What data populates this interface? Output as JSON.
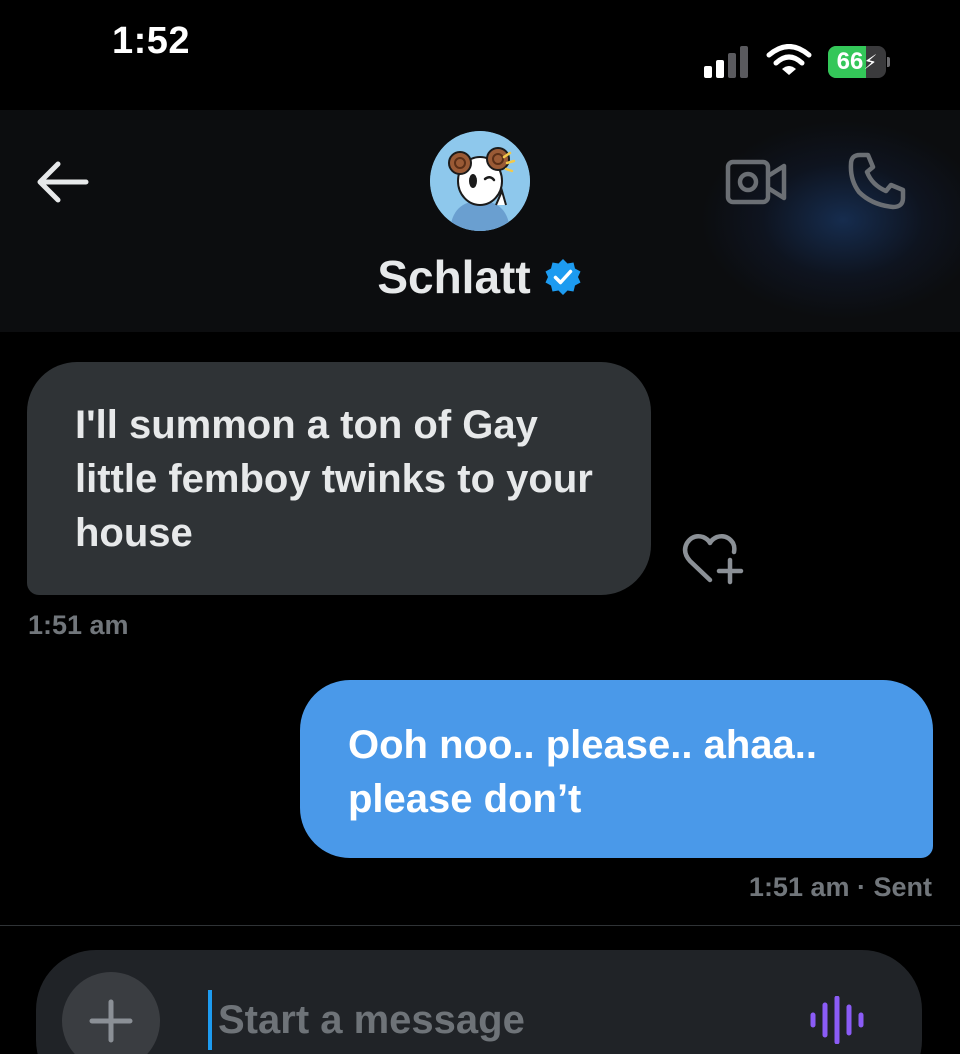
{
  "status_bar": {
    "time": "1:52",
    "battery_text": "66",
    "battery_level": 0.66,
    "signal_icon": "cellular-signal-icon",
    "wifi_icon": "wifi-icon",
    "battery_icon": "battery-charging-icon"
  },
  "header": {
    "back_icon": "arrow-left-icon",
    "contact_name": "Schlatt",
    "verified_icon": "verified-badge-icon",
    "video_icon": "video-camera-icon",
    "call_icon": "phone-icon"
  },
  "messages": [
    {
      "direction": "incoming",
      "text": "I'll summon a ton of Gay little femboy twinks to your house",
      "time": "1:51 am"
    },
    {
      "direction": "outgoing",
      "text": "Ooh noo.. please.. ahaa.. please don’t",
      "meta": "1:51 am · Sent"
    }
  ],
  "reaction_icon": "heart-plus-icon",
  "composer": {
    "add_icon": "plus-icon",
    "placeholder": "Start a message",
    "voice_icon": "voice-waveform-icon"
  },
  "colors": {
    "background": "#000000",
    "header_background": "#0c0d0f",
    "incoming_bubble": "#2f3336",
    "outgoing_bubble": "#4a99e9",
    "secondary_text": "#71767b",
    "accent": "#1d9bf0",
    "voice_icon": "#8b5cf6",
    "battery": "#34c759"
  }
}
